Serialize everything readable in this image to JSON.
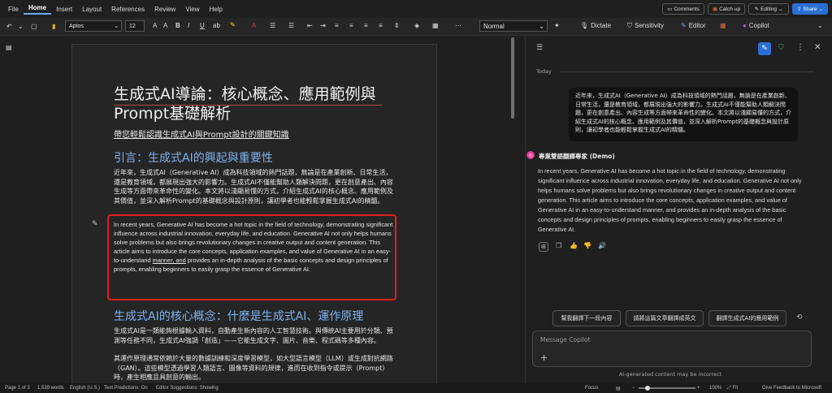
{
  "menubar": {
    "items": [
      "File",
      "Home",
      "Insert",
      "Layout",
      "References",
      "Review",
      "View",
      "Help"
    ],
    "active": "Home",
    "comments_label": "Comments",
    "catchup_label": "Catch up",
    "editing_label": "Editing",
    "share_label": "Share"
  },
  "ribbon": {
    "font_name": "Aptos",
    "font_size": "12",
    "style_name": "Normal",
    "dictate_label": "Dictate",
    "sensitivity_label": "Sensitivity",
    "editor_label": "Editor",
    "copilot_label": "Copilot",
    "bold": "B",
    "italic": "I",
    "underline": "U"
  },
  "document": {
    "title": "生成式AI導論：核心概念、應用範例與Prompt基礎解析",
    "subtitle": "帶您輕鬆認識生成式AI與Prompt設計的關鍵知識",
    "heading1": "引言：生成式AI的興起與重要性",
    "para1": "近年來，生成式AI（Generative AI）成為科技領域的熱門話題，無論是在產業創新、日常生活，還是教育領域，都展現出強大的影響力。生成式AI不僅能幫助人類解決問題，更在創意產出、內容生成等方面帶來革命性的變化。本文將以淺顯易懂的方式，介紹生成式AI的核心概念、應用範例及其價值，並深入解析Prompt的基礎概念與設計原則，讓初學者也能輕鬆掌握生成式AI的精髓。",
    "para_en_1": "In recent years, Generative AI has become a hot topic in the field of technology, demonstrating significant influence across industrial innovation, everyday life, and education. Generative AI not only helps humans solve problems but also brings revolutionary changes in creative output and content generation. This article aims to introduce the core concepts, application examples, and value of Generative AI in an easy-to-understand ",
    "para_en_underlined": "manner, and",
    "para_en_2": " provides an in-depth analysis of the basic concepts and design principles of prompts, enabling beginners to easily grasp the essence of Generative AI.",
    "heading2": "生成式AI的核心概念：什麼是生成式AI、運作原理",
    "para2": "生成式AI是一類能夠根據輸入資料，自動產生新內容的人工智慧技術。與傳統AI主要用於分類、預測等任務不同，生成式AI強調「創造」——它能生成文字、圖片、音樂、程式碼等多種內容。",
    "para3": "其運作原理通常依賴於大量的數據訓練和深度學習模型，如大型語言模型（LLM）或生成對抗網路（GAN）。這些模型透過學習人類語言、圖像等資料的規律，進而在收到指令或提示（Prompt）時，產生相應且具創意的輸出。"
  },
  "copilot": {
    "today_label": "Today",
    "user_message": "近年來，生成式AI（Generative AI）成為科技領域的熱門話題，無論是在產業創新、日常生活，還是教育領域，都展現出強大的影響力。生成式AI不僅能幫助人類解決問題，更在創意產出、內容生成等方面帶來革命性的變化。本文將以淺顯易懂的方式，介紹生成式AI的核心概念、應用範例及其價值，並深入解析Prompt的基礎概念與設計原則，讓初學者也能輕鬆掌握生成式AI的精髓。",
    "agent_name": "專業雙語翻譯專家 (Demo)",
    "reply": "In recent years, Generative AI has become a hot topic in the field of technology, demonstrating significant influence across industrial innovation, everyday life, and education. Generative AI not only helps humans solve problems but also brings revolutionary changes in creative output and content generation. This article aims to introduce the core concepts, application examples, and value of Generative AI in an easy-to-understand manner, and provides an in-depth analysis of the basic concepts and design principles of prompts, enabling beginners to easily grasp the essence of Generative AI.",
    "suggestions": [
      "幫我翻譯下一段內容",
      "請將這篇文章翻譯成英文",
      "翻譯生成式AI的應用範例"
    ],
    "message_placeholder": "Message Copilot",
    "disclaimer": "AI-generated content may be incorrect"
  },
  "statusbar": {
    "page": "Page 1 of 3",
    "words": "1,539 words",
    "language": "English (U.S.)",
    "text_predictions": "Text Predictions: On",
    "editor_suggestions": "Editor Suggestions: Showing",
    "focus": "Focus",
    "zoom": "100%",
    "fit": "Fit",
    "feedback": "Give Feedback to Microsoft"
  },
  "colors": {
    "accent": "#2b6fd6",
    "heading": "#7fb2f0",
    "highlight_box": "#e02020",
    "copilot_brand": "#e0399a"
  }
}
